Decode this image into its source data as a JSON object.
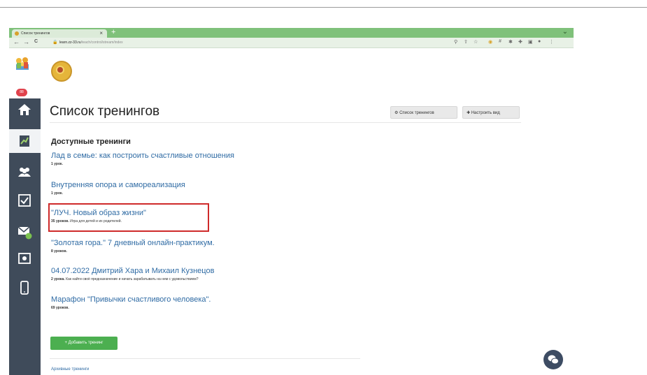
{
  "browser": {
    "tab_title": "Список тренингов",
    "tab_close": "×",
    "new_tab": "+",
    "window_control": "⌄",
    "nav_back": "←",
    "nav_forward": "→",
    "nav_reload": "C",
    "url_host": "learn.zz-33.ru",
    "url_path": "/teach/control/stream/index"
  },
  "sidebar": {
    "badge": "88"
  },
  "page": {
    "title": "Список тренингов",
    "btn_list": "Список тренингов",
    "btn_view": "Настроить вид",
    "section_title": "Доступные тренинги",
    "trainings": [
      {
        "title": "Лад в семье: как построить счастливые отношения",
        "lessons": "1 урок.",
        "desc": ""
      },
      {
        "title": "Внутренняя опора и самореализация",
        "lessons": "1 урок.",
        "desc": ""
      },
      {
        "title": "\"ЛУЧ. Новый образ жизни\"",
        "lessons": "35 уроков.",
        "desc": "Игра для детей и их родителей."
      },
      {
        "title": "\"Золотая гора.\" 7 дневный онлайн-практикум.",
        "lessons": "8 уроков.",
        "desc": ""
      },
      {
        "title": "04.07.2022 Дмитрий Хара и Михаил Кузнецов",
        "lessons": "2 урока.",
        "desc": "Как найти своё предназначение и начать зарабатывать на нем с удовольствием?"
      },
      {
        "title": "Марафон \"Привычки счастливого человека\".",
        "lessons": "69 уроков.",
        "desc": ""
      }
    ],
    "add_button": "+ Добавить тренинг",
    "archive_link": "Архивные тренинги"
  },
  "colors": {
    "accent_link": "#2f6ba4",
    "sidebar_bg": "#3f4b5a",
    "add_button": "#4caf50",
    "highlight_box": "#cf2a2a",
    "tabbar": "#7fc17a"
  },
  "icons": [
    "home-icon",
    "chart-icon",
    "users-icon",
    "checkbox-icon",
    "mail-icon",
    "camera-icon",
    "mobile-icon",
    "chat-icon"
  ]
}
